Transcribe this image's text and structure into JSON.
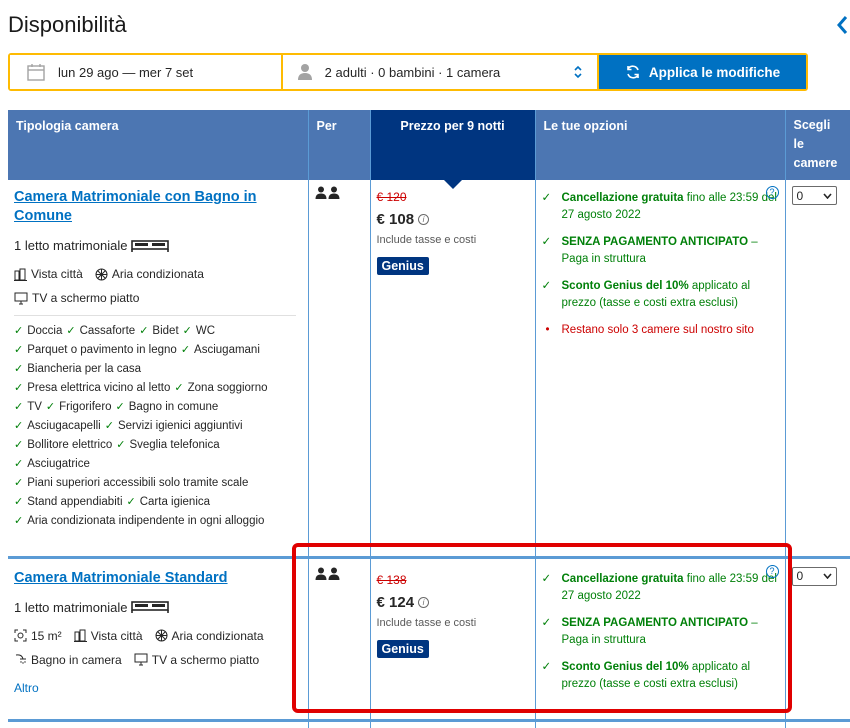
{
  "page": {
    "title": "Disponibilità"
  },
  "search": {
    "dates": "lun 29 ago — mer 7 set",
    "guests": "2 adulti · 0 bambini · 1 camera",
    "apply_label": "Applica le modifiche"
  },
  "table": {
    "headers": {
      "room_type": "Tipologia camera",
      "for": "Per",
      "price": "Prezzo per 9 notti",
      "options": "Le tue opzioni",
      "choose": "Scegli le camere"
    },
    "rooms": [
      {
        "name": "Camera Matrimoniale con Bagno in Comune",
        "bed": "1 letto matrimoniale",
        "facilities_line1": [
          "Vista città",
          "Aria condizionata"
        ],
        "facilities_line2": [
          "TV a schermo piatto"
        ],
        "amenities": [
          [
            "Doccia",
            "Cassaforte",
            "Bidet",
            "WC"
          ],
          [
            "Parquet o pavimento in legno",
            "Asciugamani"
          ],
          [
            "Biancheria per la casa"
          ],
          [
            "Presa elettrica vicino al letto",
            "Zona soggiorno"
          ],
          [
            "TV",
            "Frigorifero",
            "Bagno in comune"
          ],
          [
            "Asciugacapelli",
            "Servizi igienici aggiuntivi"
          ],
          [
            "Bollitore elettrico",
            "Sveglia telefonica"
          ],
          [
            "Asciugatrice"
          ],
          [
            "Piani superiori accessibili solo tramite scale"
          ],
          [
            "Stand appendiabiti",
            "Carta igienica"
          ],
          [
            "Aria condizionata indipendente in ogni alloggio"
          ]
        ],
        "old_price": "€ 120",
        "new_price": "€ 108",
        "tax_note": "Include tasse e costi",
        "badge": "Genius",
        "opt1_bold": "Cancellazione gratuita",
        "opt1_rest": " fino alle 23:59 del 27 agosto 2022",
        "opt2_bold": "SENZA PAGAMENTO ANTICIPATO",
        "opt2_rest": " – Paga in struttura",
        "opt3_bold": "Sconto Genius del 10%",
        "opt3_rest": " applicato al prezzo (tasse e costi extra esclusi)",
        "scarcity": "Restano solo 3 camere sul nostro sito",
        "select_value": "0"
      },
      {
        "name": "Camera Matrimoniale Standard",
        "bed": "1 letto matrimoniale",
        "facilities_line1": [
          "15 m²",
          "Vista città",
          "Aria condizionata"
        ],
        "facilities_line2": [
          "Bagno in camera",
          "TV a schermo piatto"
        ],
        "more": "Altro",
        "old_price": "€ 138",
        "new_price": "€ 124",
        "tax_note": "Include tasse e costi",
        "badge": "Genius",
        "opt1_bold": "Cancellazione gratuita",
        "opt1_rest": " fino alle 23:59 del 27 agosto 2022",
        "opt2_bold": "SENZA PAGAMENTO ANTICIPATO",
        "opt2_rest": " – Paga in struttura",
        "opt3_bold": "Sconto Genius del 10%",
        "opt3_rest": " applicato al prezzo (tasse e costi extra esclusi)",
        "select_value": "0"
      }
    ]
  },
  "colors": {
    "header_bg": "#4c76b2",
    "price_header_bg": "#003580",
    "link": "#0071c2",
    "green": "#008009",
    "red": "#cc0000",
    "search_border": "#febb02",
    "highlight": "#e00000"
  }
}
